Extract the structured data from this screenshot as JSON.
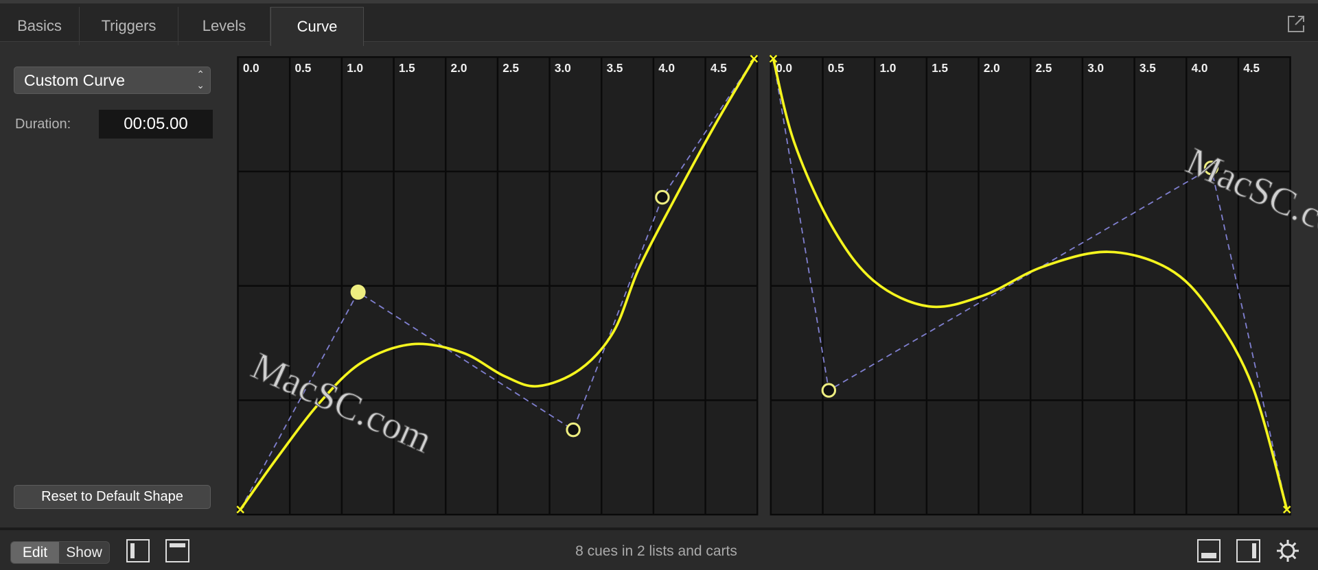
{
  "tabs": [
    {
      "label": "Basics"
    },
    {
      "label": "Triggers"
    },
    {
      "label": "Levels"
    },
    {
      "label": "Curve",
      "active": true
    }
  ],
  "popout_icon": "external-window-icon",
  "curve_panel": {
    "shape_select": "Custom Curve",
    "duration_label": "Duration:",
    "duration_value": "00:05.00",
    "reset_button": "Reset to Default Shape"
  },
  "graph_ticks": [
    "0.0",
    "0.5",
    "1.0",
    "1.5",
    "2.0",
    "2.5",
    "3.0",
    "3.5",
    "4.0",
    "4.5"
  ],
  "watermark": "MacSC.com",
  "colors": {
    "curve": "#f5f51e",
    "handle_line": "#7f7fcf",
    "grid_bg": "#1f1f1f",
    "grid_line": "#0a0a0a"
  },
  "bottom_bar": {
    "mode_edit": "Edit",
    "mode_show": "Show",
    "status": "8 cues in 2 lists and carts",
    "icons": [
      "left-sidebar-icon",
      "top-panel-icon",
      "bottom-panel-icon",
      "right-sidebar-icon",
      "gear-icon"
    ]
  }
}
